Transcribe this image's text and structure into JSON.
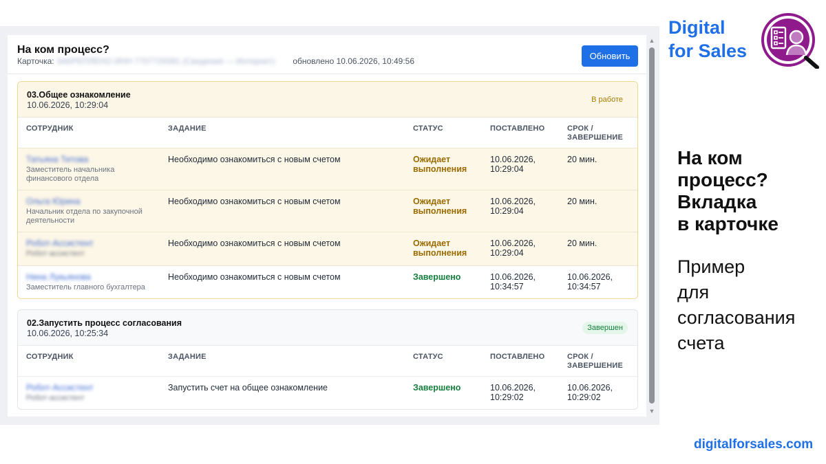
{
  "panel": {
    "title": "На ком процесс?",
    "card_label": "Карточка:",
    "card_value_blurred": "ЗАКРЕПЛЕНО ИНН 7707725581 (Сведения — Интернет)",
    "updated": "обновлено 10.06.2026, 10:49:56",
    "refresh_button": "Обновить"
  },
  "columns": {
    "employee": "СОТРУДНИК",
    "task": "ЗАДАНИЕ",
    "status": "СТАТУС",
    "assigned": "ПОСТАВЛЕНО",
    "due": "СРОК / ЗАВЕРШЕНИЕ"
  },
  "stages": [
    {
      "title": "03.Общее ознакомление",
      "date": "10.06.2026, 10:29:04",
      "badge": "В работе",
      "rows": [
        {
          "name": "Татьяна Титова",
          "position": "Заместитель начальника финансового отдела",
          "position_blurred": false,
          "task": "Необходимо ознакомиться с новым счетом",
          "status": "Ожидает выполнения",
          "assigned": "10.06.2026, 10:29:04",
          "due": "20 мин."
        },
        {
          "name": "Ольга Юрина",
          "position": "Начальник отдела по закупочной деятельности",
          "position_blurred": false,
          "task": "Необходимо ознакомиться с новым счетом",
          "status": "Ожидает выполнения",
          "assigned": "10.06.2026, 10:29:04",
          "due": "20 мин."
        },
        {
          "name": "Робот-Ассистент",
          "position": "Робот-ассистент",
          "position_blurred": true,
          "task": "Необходимо ознакомиться с новым счетом",
          "status": "Ожидает выполнения",
          "assigned": "10.06.2026, 10:29:04",
          "due": "20 мин."
        },
        {
          "name": "Нина Лукьянова",
          "position": "Заместитель главного бухгалтера",
          "position_blurred": false,
          "task": "Необходимо ознакомиться с новым счетом",
          "status": "Завершено",
          "assigned": "10.06.2026, 10:34:57",
          "due": "10.06.2026, 10:34:57"
        }
      ]
    },
    {
      "title": "02.Запустить процесс согласования",
      "date": "10.06.2026, 10:25:34",
      "badge": "Завершен",
      "rows": [
        {
          "name": "Робот-Ассистент",
          "position": "Робот-ассистент",
          "position_blurred": true,
          "task": "Запустить счет на общее ознакомление",
          "status": "Завершено",
          "assigned": "10.06.2026, 10:29:02",
          "due": "10.06.2026, 10:29:02"
        }
      ]
    }
  ],
  "promo": {
    "brand_line1": "Digital",
    "brand_line2": "for Sales",
    "title_line1": "На ком",
    "title_line2": "процесс?",
    "title_line3": "Вкладка",
    "title_line4": "в карточке",
    "sub_line1": "Пример",
    "sub_line2": "для",
    "sub_line3": "согласования",
    "sub_line4": "счета",
    "site": "digitalforsales.com",
    "logo_icon": "checklist-magnifier-person-icon"
  },
  "colors": {
    "accent": "#1f6fe6",
    "waiting": "#9a6b00",
    "done": "#15803d",
    "brand_purple": "#8e1a8c"
  }
}
